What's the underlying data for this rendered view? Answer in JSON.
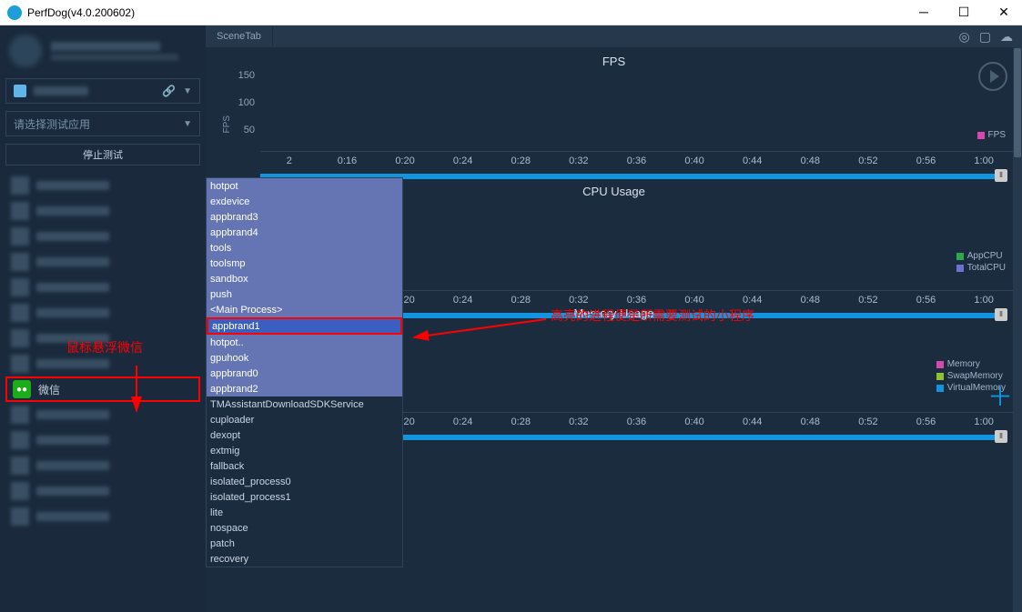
{
  "titlebar": {
    "title": "PerfDog(v4.0.200602)"
  },
  "sidebar": {
    "app_select_placeholder": "请选择测试应用",
    "stop_button": "停止测试",
    "wechat_label": "微信"
  },
  "sceneTab": {
    "label": "SceneTab"
  },
  "charts": {
    "fps": {
      "title": "FPS",
      "ylabel": "FPS",
      "yticks": [
        "150",
        "100",
        "50"
      ],
      "legend": [
        {
          "label": "FPS",
          "color": "#d847b0"
        }
      ]
    },
    "cpu": {
      "title": "CPU Usage",
      "legend": [
        {
          "label": "AppCPU",
          "color": "#2ea84f"
        },
        {
          "label": "TotalCPU",
          "color": "#6f6fd8"
        }
      ]
    },
    "memory": {
      "title": "Memory Usage",
      "legend": [
        {
          "label": "Memory",
          "color": "#d847b0"
        },
        {
          "label": "SwapMemory",
          "color": "#8fc131"
        },
        {
          "label": "VirtualMemory",
          "color": "#1195df"
        }
      ]
    },
    "time_ticks": [
      "2",
      "0:16",
      "0:20",
      "0:24",
      "0:28",
      "0:32",
      "0:36",
      "0:40",
      "0:44",
      "0:48",
      "0:52",
      "0:56",
      "1:00"
    ]
  },
  "process_list": [
    {
      "name": "hotpot",
      "hl": true
    },
    {
      "name": "exdevice",
      "hl": true
    },
    {
      "name": "appbrand3",
      "hl": true
    },
    {
      "name": "appbrand4",
      "hl": true
    },
    {
      "name": "tools",
      "hl": true
    },
    {
      "name": "toolsmp",
      "hl": true
    },
    {
      "name": "sandbox",
      "hl": true
    },
    {
      "name": "push",
      "hl": true
    },
    {
      "name": "<Main Process>",
      "hl": true
    },
    {
      "name": "appbrand1",
      "selected": true
    },
    {
      "name": "hotpot..",
      "hl": true
    },
    {
      "name": "gpuhook",
      "hl": true
    },
    {
      "name": "appbrand0",
      "hl": true
    },
    {
      "name": "appbrand2",
      "hl": true
    },
    {
      "name": "TMAssistantDownloadSDKService",
      "hl": false
    },
    {
      "name": "cuploader",
      "hl": false
    },
    {
      "name": "dexopt",
      "hl": false
    },
    {
      "name": "extmig",
      "hl": false
    },
    {
      "name": "fallback",
      "hl": false
    },
    {
      "name": "isolated_process0",
      "hl": false
    },
    {
      "name": "isolated_process1",
      "hl": false
    },
    {
      "name": "lite",
      "hl": false
    },
    {
      "name": "nospace",
      "hl": false
    },
    {
      "name": "patch",
      "hl": false
    },
    {
      "name": "recovery",
      "hl": false
    }
  ],
  "annotations": {
    "hover_wechat": "鼠标悬浮微信",
    "highlighted_process": "高亮的进程便是所需要测试的小程序"
  },
  "chart_data": [
    {
      "type": "line",
      "title": "FPS",
      "ylabel": "FPS",
      "ylim": [
        0,
        150
      ],
      "series": [
        {
          "name": "FPS",
          "values": []
        }
      ],
      "x_range_seconds": [
        12,
        60
      ]
    },
    {
      "type": "line",
      "title": "CPU Usage",
      "series": [
        {
          "name": "AppCPU",
          "values": []
        },
        {
          "name": "TotalCPU",
          "values": []
        }
      ],
      "x_range_seconds": [
        12,
        60
      ]
    },
    {
      "type": "line",
      "title": "Memory Usage",
      "series": [
        {
          "name": "Memory",
          "values": []
        },
        {
          "name": "SwapMemory",
          "values": []
        },
        {
          "name": "VirtualMemory",
          "values": []
        }
      ],
      "x_range_seconds": [
        12,
        60
      ]
    }
  ]
}
